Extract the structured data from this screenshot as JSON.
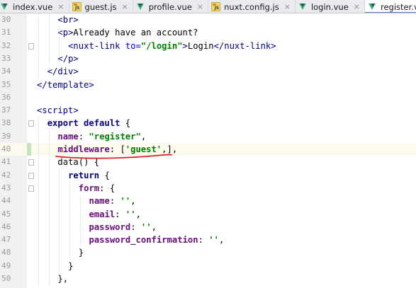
{
  "tabs": [
    {
      "label": "index.vue",
      "icon": "vue-file-icon",
      "active": false
    },
    {
      "label": "guest.js",
      "icon": "js-file-icon",
      "active": false
    },
    {
      "label": "profile.vue",
      "icon": "vue-file-icon",
      "active": false
    },
    {
      "label": "nuxt.config.js",
      "icon": "js-file-icon",
      "active": false
    },
    {
      "label": "login.vue",
      "icon": "vue-file-icon",
      "active": false
    },
    {
      "label": "register.vue",
      "icon": "vue-file-icon",
      "active": true
    }
  ],
  "close_glyph": "×",
  "current_line": 40,
  "annotation_color": "#e02020",
  "lines": [
    {
      "n": "30",
      "indent": 4,
      "tokens": [
        {
          "t": "<br>",
          "c": "tag"
        }
      ]
    },
    {
      "n": "31",
      "indent": 4,
      "tokens": [
        {
          "t": "<p>",
          "c": "tag"
        },
        {
          "t": "Already have an account?",
          "c": "plain"
        }
      ]
    },
    {
      "n": "32",
      "indent": 6,
      "tokens": [
        {
          "t": "<nuxt-link ",
          "c": "tag"
        },
        {
          "t": "to=",
          "c": "attr"
        },
        {
          "t": "\"/login\"",
          "c": "val"
        },
        {
          "t": ">",
          "c": "tag"
        },
        {
          "t": "Login",
          "c": "plain"
        },
        {
          "t": "</nuxt-link>",
          "c": "tag"
        }
      ]
    },
    {
      "n": "33",
      "indent": 4,
      "tokens": [
        {
          "t": "</p>",
          "c": "tag"
        }
      ]
    },
    {
      "n": "34",
      "indent": 2,
      "tokens": [
        {
          "t": "</div>",
          "c": "tag"
        }
      ]
    },
    {
      "n": "35",
      "indent": 0,
      "tokens": [
        {
          "t": "</template>",
          "c": "tag"
        }
      ]
    },
    {
      "n": "36",
      "indent": 0,
      "tokens": []
    },
    {
      "n": "37",
      "indent": 0,
      "tokens": [
        {
          "t": "<script>",
          "c": "tag"
        }
      ]
    },
    {
      "n": "38",
      "indent": 2,
      "tokens": [
        {
          "t": "export default ",
          "c": "kw"
        },
        {
          "t": "{",
          "c": "plain"
        }
      ]
    },
    {
      "n": "39",
      "indent": 4,
      "tokens": [
        {
          "t": "name",
          "c": "prop"
        },
        {
          "t": ": ",
          "c": "plain"
        },
        {
          "t": "\"register\"",
          "c": "str"
        },
        {
          "t": ",",
          "c": "plain"
        }
      ]
    },
    {
      "n": "40",
      "indent": 4,
      "tokens": [
        {
          "t": "middleware",
          "c": "prop"
        },
        {
          "t": ": [",
          "c": "plain"
        },
        {
          "t": "'guest'",
          "c": "str"
        },
        {
          "t": ",],",
          "c": "plain"
        }
      ]
    },
    {
      "n": "41",
      "indent": 4,
      "tokens": [
        {
          "t": "data",
          "c": "plain"
        },
        {
          "t": "() {",
          "c": "plain"
        }
      ]
    },
    {
      "n": "42",
      "indent": 6,
      "tokens": [
        {
          "t": "return ",
          "c": "kw"
        },
        {
          "t": "{",
          "c": "plain"
        }
      ]
    },
    {
      "n": "43",
      "indent": 8,
      "tokens": [
        {
          "t": "form",
          "c": "prop"
        },
        {
          "t": ": {",
          "c": "plain"
        }
      ]
    },
    {
      "n": "44",
      "indent": 10,
      "tokens": [
        {
          "t": "name",
          "c": "prop"
        },
        {
          "t": ": ",
          "c": "plain"
        },
        {
          "t": "''",
          "c": "str"
        },
        {
          "t": ",",
          "c": "plain"
        }
      ]
    },
    {
      "n": "45",
      "indent": 10,
      "tokens": [
        {
          "t": "email",
          "c": "prop"
        },
        {
          "t": ": ",
          "c": "plain"
        },
        {
          "t": "''",
          "c": "str"
        },
        {
          "t": ",",
          "c": "plain"
        }
      ]
    },
    {
      "n": "46",
      "indent": 10,
      "tokens": [
        {
          "t": "password",
          "c": "prop"
        },
        {
          "t": ": ",
          "c": "plain"
        },
        {
          "t": "''",
          "c": "str"
        },
        {
          "t": ",",
          "c": "plain"
        }
      ]
    },
    {
      "n": "47",
      "indent": 10,
      "tokens": [
        {
          "t": "password_confirmation",
          "c": "prop"
        },
        {
          "t": ": ",
          "c": "plain"
        },
        {
          "t": "''",
          "c": "str"
        },
        {
          "t": ",",
          "c": "plain"
        }
      ]
    },
    {
      "n": "48",
      "indent": 8,
      "tokens": [
        {
          "t": "}",
          "c": "plain"
        }
      ]
    },
    {
      "n": "49",
      "indent": 6,
      "tokens": [
        {
          "t": "}",
          "c": "plain"
        }
      ]
    },
    {
      "n": "50",
      "indent": 4,
      "tokens": [
        {
          "t": "},",
          "c": "plain"
        }
      ]
    }
  ]
}
